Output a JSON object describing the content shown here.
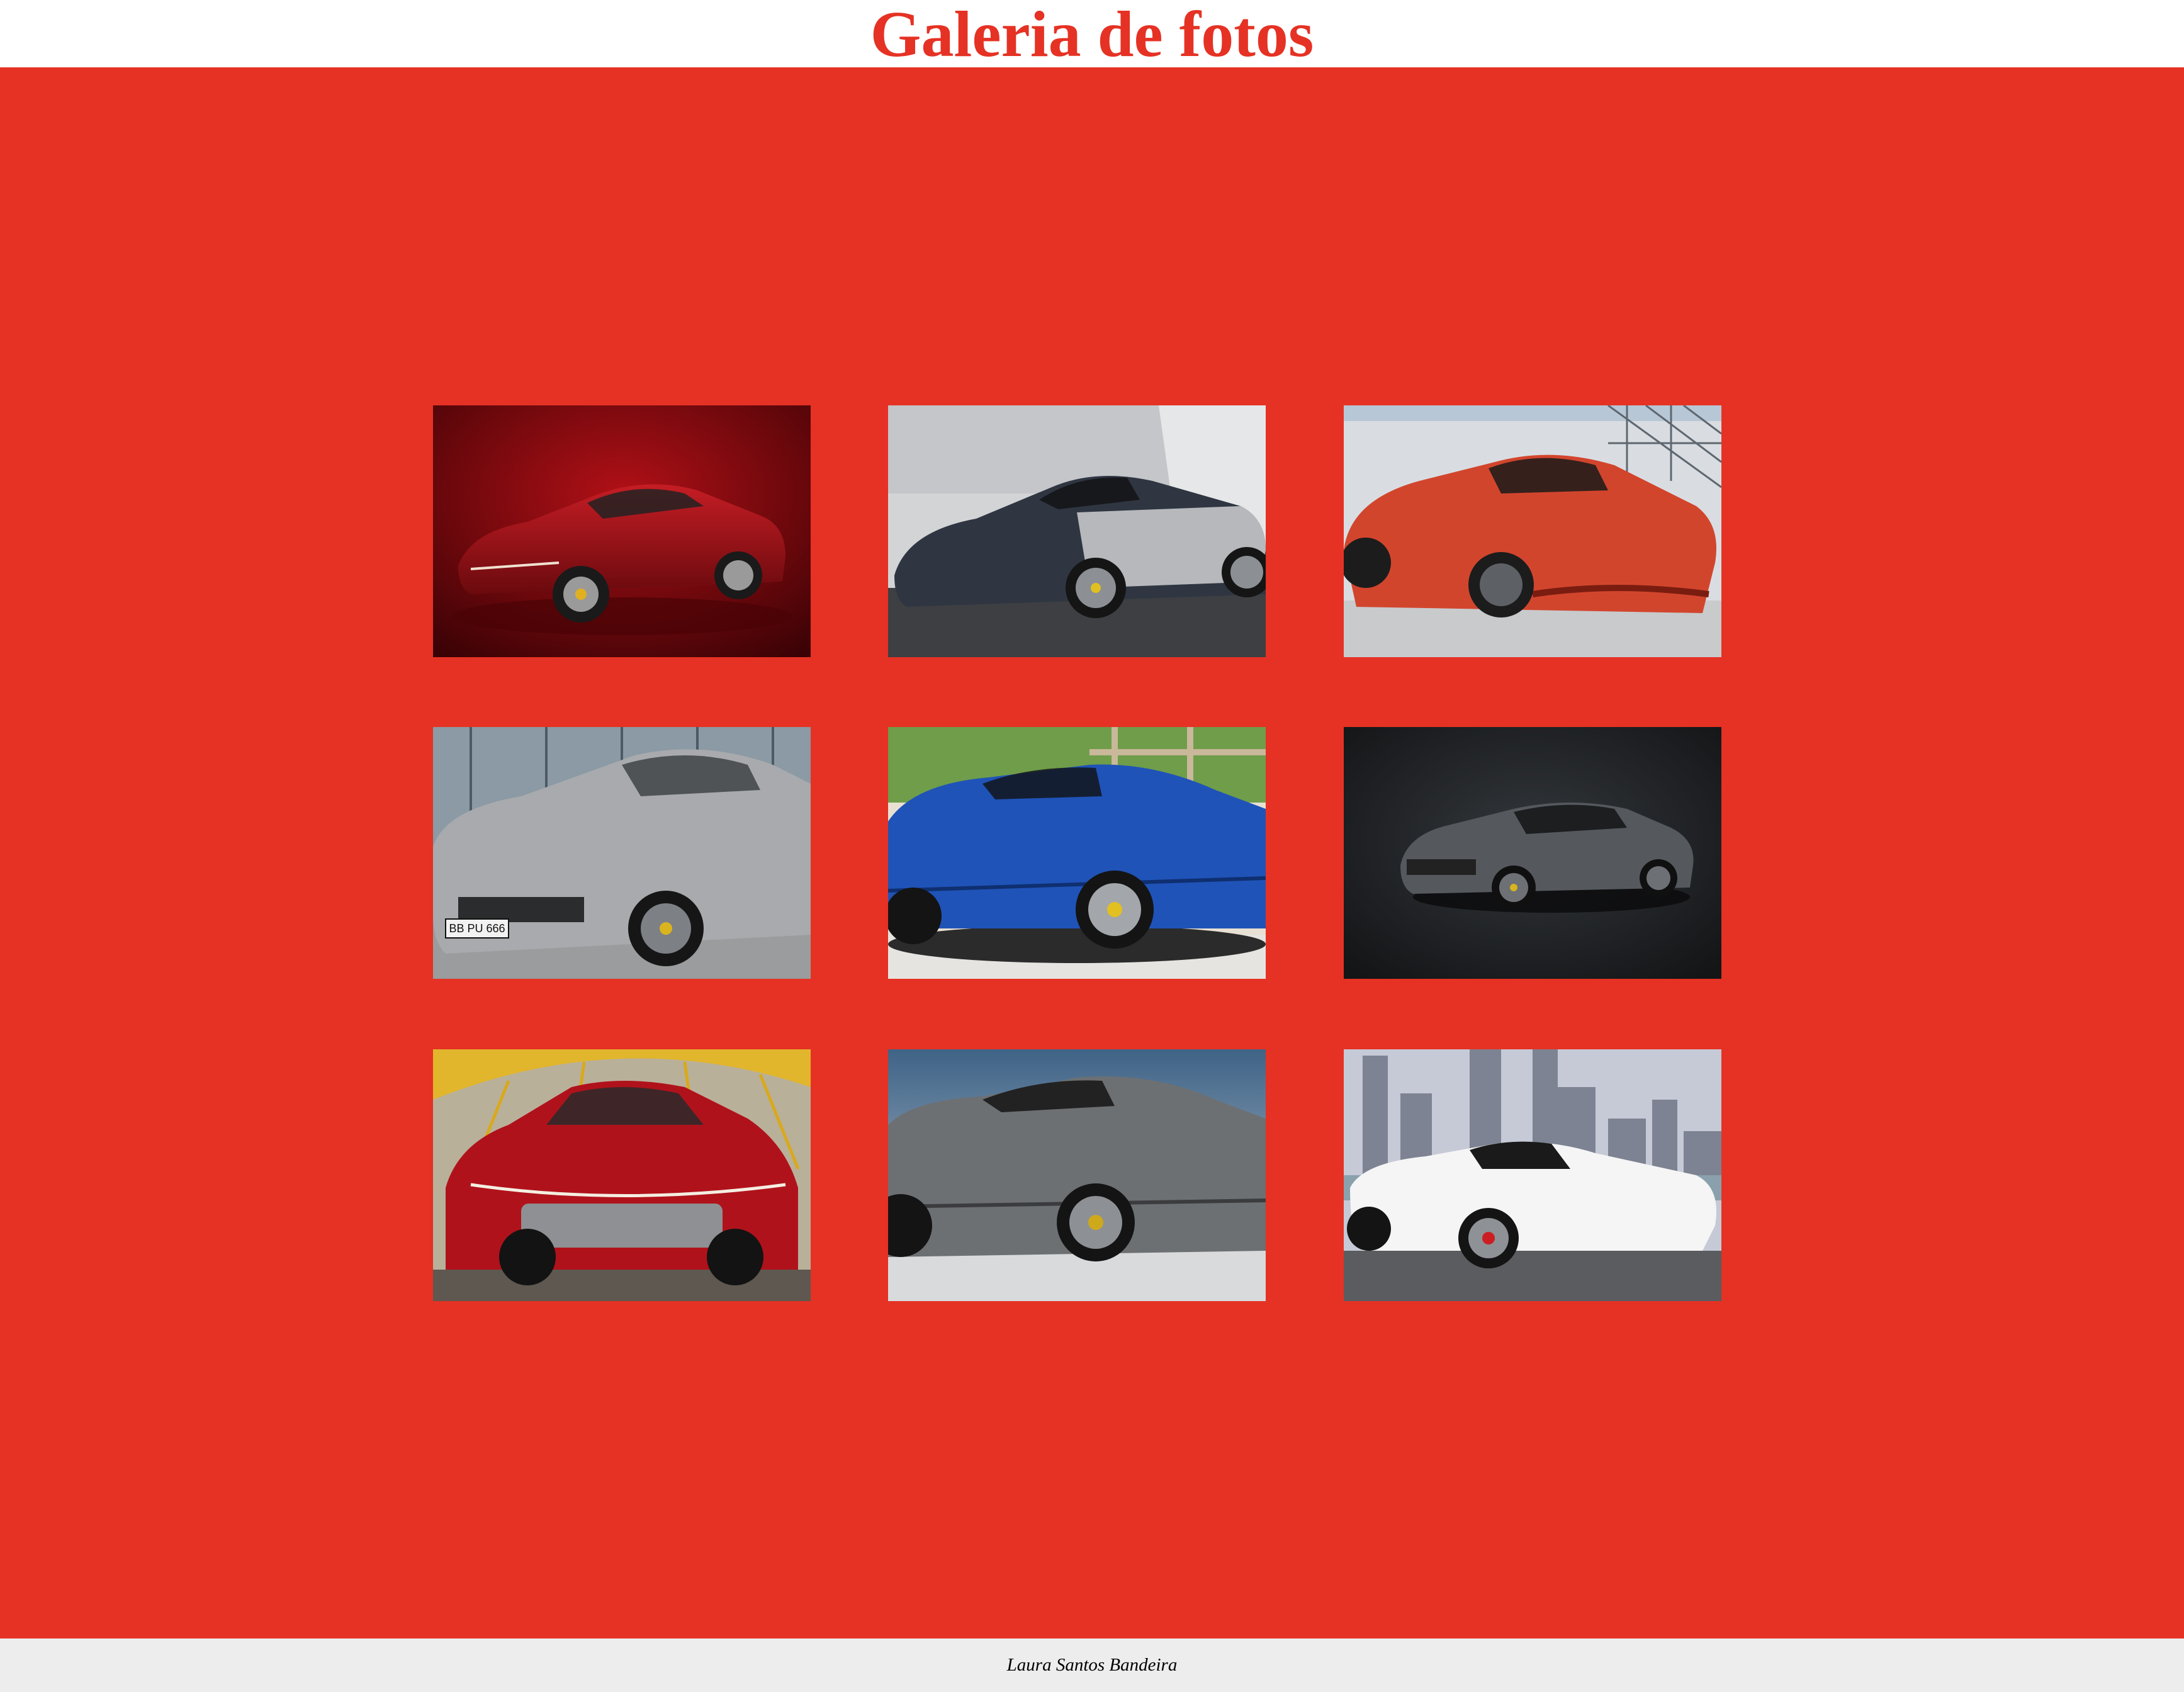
{
  "header": {
    "title": "Galeria de fotos"
  },
  "colors": {
    "accent": "#e53224",
    "footer_bg": "#ededed",
    "title_color": "#e53224"
  },
  "gallery": {
    "photos": [
      {
        "subject": "red sports coupe on dark red studio backdrop"
      },
      {
        "subject": "dark grey open-top sports car with silver flank in front of a concrete wall"
      },
      {
        "subject": "orange-red hypercar in a glass-roofed showroom"
      },
      {
        "subject": "silver SUV-style coupe in front of a glass building",
        "plate": "BB PU 666"
      },
      {
        "subject": "blue four-door grand tourer in a showroom with trees behind"
      },
      {
        "subject": "dark grey SUV-style coupe on black studio backdrop"
      },
      {
        "subject": "red SUV-style coupe under a yellow bridge arch"
      },
      {
        "subject": "grey four-door grand tourer against a blue sky"
      },
      {
        "subject": "white sports car in front of a city skyline"
      }
    ]
  },
  "footer": {
    "author": "Laura Santos Bandeira"
  }
}
